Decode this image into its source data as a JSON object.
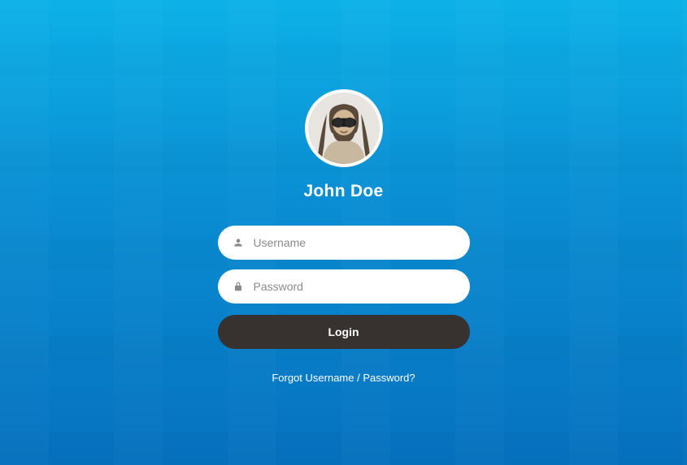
{
  "user": {
    "name": "John Doe"
  },
  "form": {
    "username": {
      "placeholder": "Username",
      "value": ""
    },
    "password": {
      "placeholder": "Password",
      "value": ""
    },
    "login_label": "Login",
    "forgot_label": "Forgot Username / Password?"
  },
  "icons": {
    "username": "user-icon",
    "password": "lock-icon"
  }
}
